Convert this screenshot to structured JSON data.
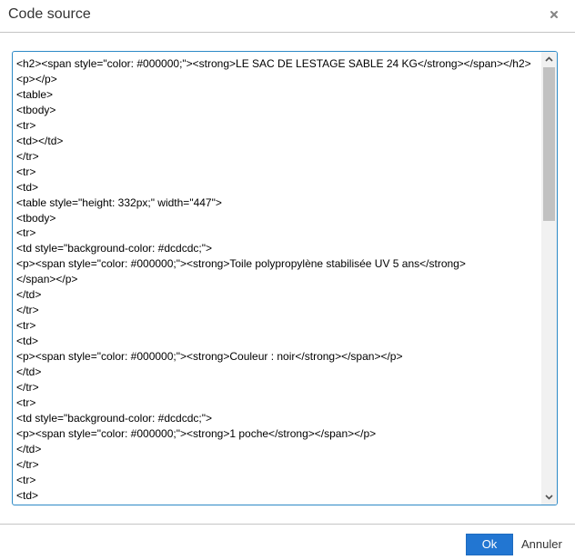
{
  "dialog": {
    "title": "Code source",
    "close_icon": "close-icon"
  },
  "editor": {
    "source_code": "<h2><span style=\"color: #000000;\"><strong>LE SAC DE LESTAGE SABLE 24 KG</strong></span></h2>\n<p></p>\n<table>\n<tbody>\n<tr>\n<td></td>\n</tr>\n<tr>\n<td>\n<table style=\"height: 332px;\" width=\"447\">\n<tbody>\n<tr>\n<td style=\"background-color: #dcdcdc;\">\n<p><span style=\"color: #000000;\"><strong>Toile polypropylène stabilisée UV 5 ans</strong>\n</span></p>\n</td>\n</tr>\n<tr>\n<td>\n<p><span style=\"color: #000000;\"><strong>Couleur : noir</strong></span></p>\n</td>\n</tr>\n<tr>\n<td style=\"background-color: #dcdcdc;\">\n<p><span style=\"color: #000000;\"><strong>1 poche</strong></span></p>\n</td>\n</tr>\n<tr>\n<td>",
    "scroll_up_icon": "chevron-up-icon",
    "scroll_down_icon": "chevron-down-icon"
  },
  "footer": {
    "ok_label": "Ok",
    "cancel_label": "Annuler"
  },
  "colors": {
    "accent": "#2276d2",
    "focus_border": "#2d8ac7",
    "scroll_track": "#f1f1f1",
    "scroll_thumb": "#c1c1c1"
  }
}
